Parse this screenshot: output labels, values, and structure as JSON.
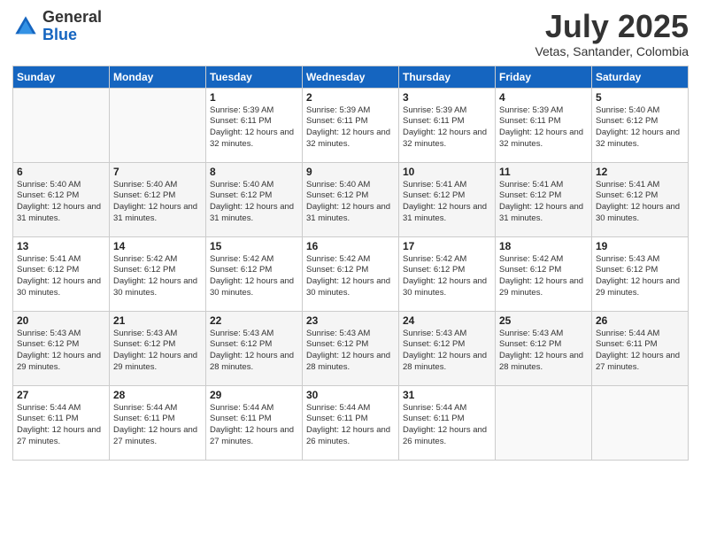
{
  "header": {
    "logo_general": "General",
    "logo_blue": "Blue",
    "month_title": "July 2025",
    "location": "Vetas, Santander, Colombia"
  },
  "days_of_week": [
    "Sunday",
    "Monday",
    "Tuesday",
    "Wednesday",
    "Thursday",
    "Friday",
    "Saturday"
  ],
  "weeks": [
    [
      {
        "num": "",
        "sunrise": "",
        "sunset": "",
        "daylight": "",
        "empty": true
      },
      {
        "num": "",
        "sunrise": "",
        "sunset": "",
        "daylight": "",
        "empty": true
      },
      {
        "num": "1",
        "sunrise": "Sunrise: 5:39 AM",
        "sunset": "Sunset: 6:11 PM",
        "daylight": "Daylight: 12 hours and 32 minutes.",
        "empty": false
      },
      {
        "num": "2",
        "sunrise": "Sunrise: 5:39 AM",
        "sunset": "Sunset: 6:11 PM",
        "daylight": "Daylight: 12 hours and 32 minutes.",
        "empty": false
      },
      {
        "num": "3",
        "sunrise": "Sunrise: 5:39 AM",
        "sunset": "Sunset: 6:11 PM",
        "daylight": "Daylight: 12 hours and 32 minutes.",
        "empty": false
      },
      {
        "num": "4",
        "sunrise": "Sunrise: 5:39 AM",
        "sunset": "Sunset: 6:11 PM",
        "daylight": "Daylight: 12 hours and 32 minutes.",
        "empty": false
      },
      {
        "num": "5",
        "sunrise": "Sunrise: 5:40 AM",
        "sunset": "Sunset: 6:12 PM",
        "daylight": "Daylight: 12 hours and 32 minutes.",
        "empty": false
      }
    ],
    [
      {
        "num": "6",
        "sunrise": "Sunrise: 5:40 AM",
        "sunset": "Sunset: 6:12 PM",
        "daylight": "Daylight: 12 hours and 31 minutes.",
        "empty": false
      },
      {
        "num": "7",
        "sunrise": "Sunrise: 5:40 AM",
        "sunset": "Sunset: 6:12 PM",
        "daylight": "Daylight: 12 hours and 31 minutes.",
        "empty": false
      },
      {
        "num": "8",
        "sunrise": "Sunrise: 5:40 AM",
        "sunset": "Sunset: 6:12 PM",
        "daylight": "Daylight: 12 hours and 31 minutes.",
        "empty": false
      },
      {
        "num": "9",
        "sunrise": "Sunrise: 5:40 AM",
        "sunset": "Sunset: 6:12 PM",
        "daylight": "Daylight: 12 hours and 31 minutes.",
        "empty": false
      },
      {
        "num": "10",
        "sunrise": "Sunrise: 5:41 AM",
        "sunset": "Sunset: 6:12 PM",
        "daylight": "Daylight: 12 hours and 31 minutes.",
        "empty": false
      },
      {
        "num": "11",
        "sunrise": "Sunrise: 5:41 AM",
        "sunset": "Sunset: 6:12 PM",
        "daylight": "Daylight: 12 hours and 31 minutes.",
        "empty": false
      },
      {
        "num": "12",
        "sunrise": "Sunrise: 5:41 AM",
        "sunset": "Sunset: 6:12 PM",
        "daylight": "Daylight: 12 hours and 30 minutes.",
        "empty": false
      }
    ],
    [
      {
        "num": "13",
        "sunrise": "Sunrise: 5:41 AM",
        "sunset": "Sunset: 6:12 PM",
        "daylight": "Daylight: 12 hours and 30 minutes.",
        "empty": false
      },
      {
        "num": "14",
        "sunrise": "Sunrise: 5:42 AM",
        "sunset": "Sunset: 6:12 PM",
        "daylight": "Daylight: 12 hours and 30 minutes.",
        "empty": false
      },
      {
        "num": "15",
        "sunrise": "Sunrise: 5:42 AM",
        "sunset": "Sunset: 6:12 PM",
        "daylight": "Daylight: 12 hours and 30 minutes.",
        "empty": false
      },
      {
        "num": "16",
        "sunrise": "Sunrise: 5:42 AM",
        "sunset": "Sunset: 6:12 PM",
        "daylight": "Daylight: 12 hours and 30 minutes.",
        "empty": false
      },
      {
        "num": "17",
        "sunrise": "Sunrise: 5:42 AM",
        "sunset": "Sunset: 6:12 PM",
        "daylight": "Daylight: 12 hours and 30 minutes.",
        "empty": false
      },
      {
        "num": "18",
        "sunrise": "Sunrise: 5:42 AM",
        "sunset": "Sunset: 6:12 PM",
        "daylight": "Daylight: 12 hours and 29 minutes.",
        "empty": false
      },
      {
        "num": "19",
        "sunrise": "Sunrise: 5:43 AM",
        "sunset": "Sunset: 6:12 PM",
        "daylight": "Daylight: 12 hours and 29 minutes.",
        "empty": false
      }
    ],
    [
      {
        "num": "20",
        "sunrise": "Sunrise: 5:43 AM",
        "sunset": "Sunset: 6:12 PM",
        "daylight": "Daylight: 12 hours and 29 minutes.",
        "empty": false
      },
      {
        "num": "21",
        "sunrise": "Sunrise: 5:43 AM",
        "sunset": "Sunset: 6:12 PM",
        "daylight": "Daylight: 12 hours and 29 minutes.",
        "empty": false
      },
      {
        "num": "22",
        "sunrise": "Sunrise: 5:43 AM",
        "sunset": "Sunset: 6:12 PM",
        "daylight": "Daylight: 12 hours and 28 minutes.",
        "empty": false
      },
      {
        "num": "23",
        "sunrise": "Sunrise: 5:43 AM",
        "sunset": "Sunset: 6:12 PM",
        "daylight": "Daylight: 12 hours and 28 minutes.",
        "empty": false
      },
      {
        "num": "24",
        "sunrise": "Sunrise: 5:43 AM",
        "sunset": "Sunset: 6:12 PM",
        "daylight": "Daylight: 12 hours and 28 minutes.",
        "empty": false
      },
      {
        "num": "25",
        "sunrise": "Sunrise: 5:43 AM",
        "sunset": "Sunset: 6:12 PM",
        "daylight": "Daylight: 12 hours and 28 minutes.",
        "empty": false
      },
      {
        "num": "26",
        "sunrise": "Sunrise: 5:44 AM",
        "sunset": "Sunset: 6:11 PM",
        "daylight": "Daylight: 12 hours and 27 minutes.",
        "empty": false
      }
    ],
    [
      {
        "num": "27",
        "sunrise": "Sunrise: 5:44 AM",
        "sunset": "Sunset: 6:11 PM",
        "daylight": "Daylight: 12 hours and 27 minutes.",
        "empty": false
      },
      {
        "num": "28",
        "sunrise": "Sunrise: 5:44 AM",
        "sunset": "Sunset: 6:11 PM",
        "daylight": "Daylight: 12 hours and 27 minutes.",
        "empty": false
      },
      {
        "num": "29",
        "sunrise": "Sunrise: 5:44 AM",
        "sunset": "Sunset: 6:11 PM",
        "daylight": "Daylight: 12 hours and 27 minutes.",
        "empty": false
      },
      {
        "num": "30",
        "sunrise": "Sunrise: 5:44 AM",
        "sunset": "Sunset: 6:11 PM",
        "daylight": "Daylight: 12 hours and 26 minutes.",
        "empty": false
      },
      {
        "num": "31",
        "sunrise": "Sunrise: 5:44 AM",
        "sunset": "Sunset: 6:11 PM",
        "daylight": "Daylight: 12 hours and 26 minutes.",
        "empty": false
      },
      {
        "num": "",
        "sunrise": "",
        "sunset": "",
        "daylight": "",
        "empty": true
      },
      {
        "num": "",
        "sunrise": "",
        "sunset": "",
        "daylight": "",
        "empty": true
      }
    ]
  ]
}
